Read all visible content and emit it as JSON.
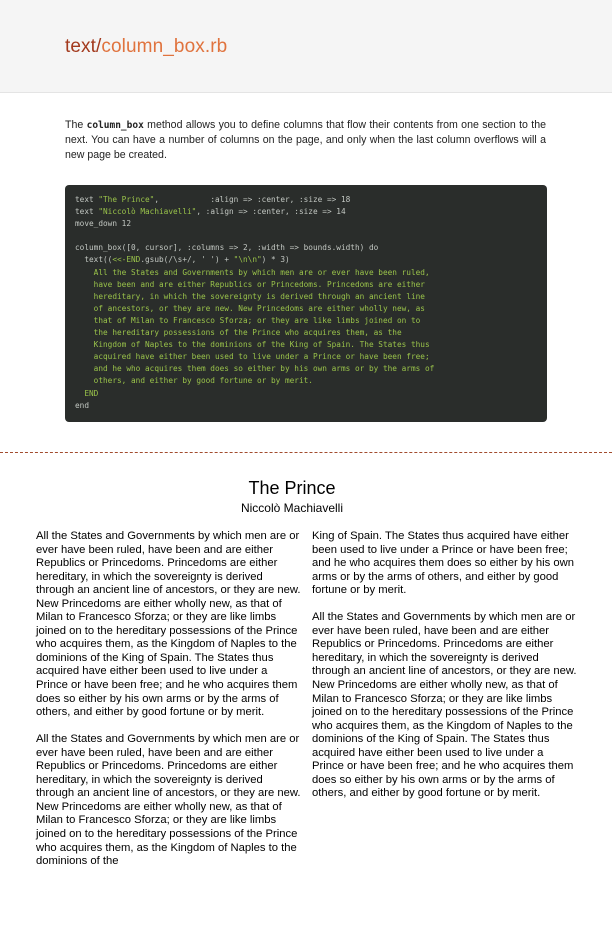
{
  "header": {
    "title_dir": "text/",
    "title_file": "column_box.rb"
  },
  "intro": {
    "before": "The ",
    "code": "column_box",
    "after": " method allows you to define columns that flow their contents from one section to the next. You can have a number of columns on the page, and only when the last column overflows will a new page be created."
  },
  "code": {
    "line1_a": "text ",
    "line1_str": "\"The Prince\"",
    "line1_b": ",           :align => :center, :size => 18",
    "line2_a": "text ",
    "line2_str": "\"Niccolò Machiavelli\"",
    "line2_b": ", :align => :center, :size => 14",
    "line3": "move_down 12",
    "line4": "",
    "line5": "column_box([0, cursor], :columns => 2, :width => bounds.width) do",
    "line6_a": "  text((",
    "line6_str": "<<-END",
    "line6_b": ".gsub(/\\s+/, ' ') + ",
    "line6_str2": "\"\\n\\n\"",
    "line6_c": ") * 3)",
    "heredoc": [
      "    All the States and Governments by which men are or ever have been ruled,",
      "    have been and are either Republics or Princedoms. Princedoms are either",
      "    hereditary, in which the sovereignty is derived through an ancient line",
      "    of ancestors, or they are new. New Princedoms are either wholly new, as",
      "    that of Milan to Francesco Sforza; or they are like limbs joined on to",
      "    the hereditary possessions of the Prince who acquires them, as the",
      "    Kingdom of Naples to the dominions of the King of Spain. The States thus",
      "    acquired have either been used to live under a Prince or have been free;",
      "    and he who acquires them does so either by his own arms or by the arms of",
      "    others, and either by good fortune or by merit."
    ],
    "line_end_heredoc": "  END",
    "line_end": "end"
  },
  "document": {
    "title": "The Prince",
    "author": "Niccolò Machiavelli",
    "left_col_p1": "All the States and Governments by which men are or ever have been ruled, have been and are either Republics or Princedoms. Princedoms are either hereditary, in which the sovereignty is derived through an ancient line of ancestors, or they are new. New Princedoms are either wholly new, as that of Milan to Francesco Sforza; or they are like limbs joined on to the hereditary possessions of the Prince who acquires them, as the Kingdom of Naples to the dominions of the King of Spain. The States thus acquired have either been used to live under a Prince or have been free; and he who acquires them does so either by his own arms or by the arms of others, and either by good fortune or by merit.",
    "left_col_p2": "All the States and Governments by which men are or ever have been ruled, have been and are either Republics or Princedoms. Princedoms are either hereditary, in which the sovereignty is derived through an ancient line of ancestors, or they are new. New Princedoms are either wholly new, as that of Milan to Francesco Sforza; or they are like limbs joined on to the hereditary possessions of the Prince who acquires them, as the Kingdom of Naples to the dominions of the",
    "right_col_p1": "King of Spain. The States thus acquired have either been used to live under a Prince or have been free; and he who acquires them does so either by his own arms or by the arms of others, and either by good fortune or by merit.",
    "right_col_p2": "All the States and Governments by which men are or ever have been ruled, have been and are either Republics or Princedoms. Princedoms are either hereditary, in which the sovereignty is derived through an ancient line of ancestors, or they are new. New Princedoms are either wholly new, as that of Milan to Francesco Sforza; or they are like limbs joined on to the hereditary possessions of the Prince who acquires them, as the Kingdom of Naples to the dominions of the King of Spain. The States thus acquired have either been used to live under a Prince or have been free; and he who acquires them does so either by his own arms or by the arms of others, and either by good fortune or by merit."
  },
  "colors": {
    "title_dir": "#a33a1e",
    "title_file": "#e0733e",
    "code_bg": "#2a2d2b",
    "code_text": "#c2c7c2",
    "code_string": "#99c24a",
    "separator": "#a24c2e"
  }
}
